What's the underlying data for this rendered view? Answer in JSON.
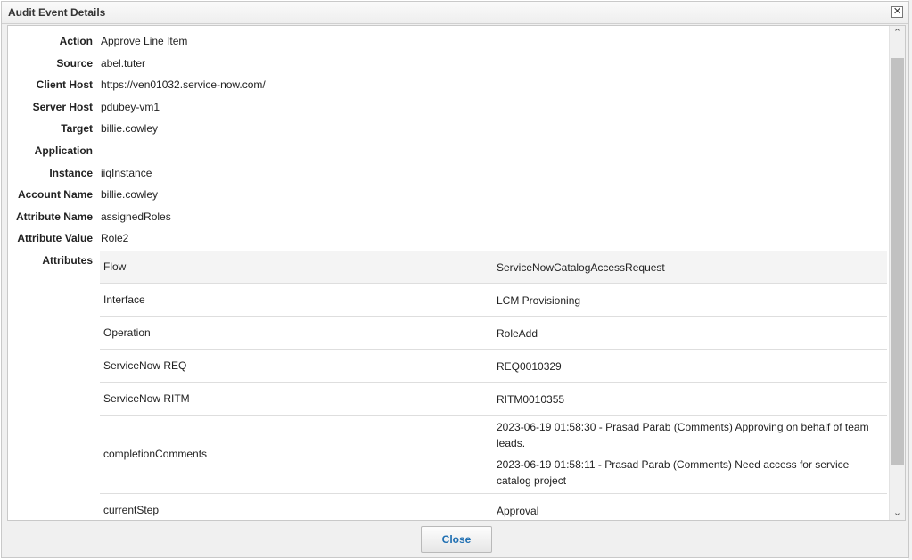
{
  "dialog": {
    "title": "Audit Event Details",
    "close_glyph": "✕",
    "close_button_label": "Close"
  },
  "fields": [
    {
      "label": "Action",
      "value": "Approve Line Item"
    },
    {
      "label": "Source",
      "value": "abel.tuter"
    },
    {
      "label": "Client Host",
      "value": "https://ven01032.service-now.com/"
    },
    {
      "label": "Server Host",
      "value": "pdubey-vm1"
    },
    {
      "label": "Target",
      "value": "billie.cowley"
    },
    {
      "label": "Application",
      "value": ""
    },
    {
      "label": "Instance",
      "value": "iiqInstance"
    },
    {
      "label": "Account Name",
      "value": "billie.cowley"
    },
    {
      "label": "Attribute Name",
      "value": "assignedRoles"
    },
    {
      "label": "Attribute Value",
      "value": "Role2"
    }
  ],
  "attributes": {
    "label": "Attributes",
    "rows": [
      {
        "name": "Flow",
        "values": [
          "ServiceNowCatalogAccessRequest"
        ]
      },
      {
        "name": "Interface",
        "values": [
          "LCM Provisioning"
        ]
      },
      {
        "name": "Operation",
        "values": [
          "RoleAdd"
        ]
      },
      {
        "name": "ServiceNow REQ",
        "values": [
          "REQ0010329"
        ]
      },
      {
        "name": "ServiceNow RITM",
        "values": [
          "RITM0010355"
        ]
      },
      {
        "name": "completionComments",
        "values": [
          "2023-06-19 01:58:30 - Prasad Parab (Comments) Approving on behalf of team leads.",
          "2023-06-19 01:58:11 - Prasad Parab (Comments) Need access for service catalog project"
        ]
      },
      {
        "name": "currentStep",
        "values": [
          "Approval"
        ]
      }
    ]
  },
  "scrollbar": {
    "up_glyph": "⌃",
    "down_glyph": "⌄"
  }
}
